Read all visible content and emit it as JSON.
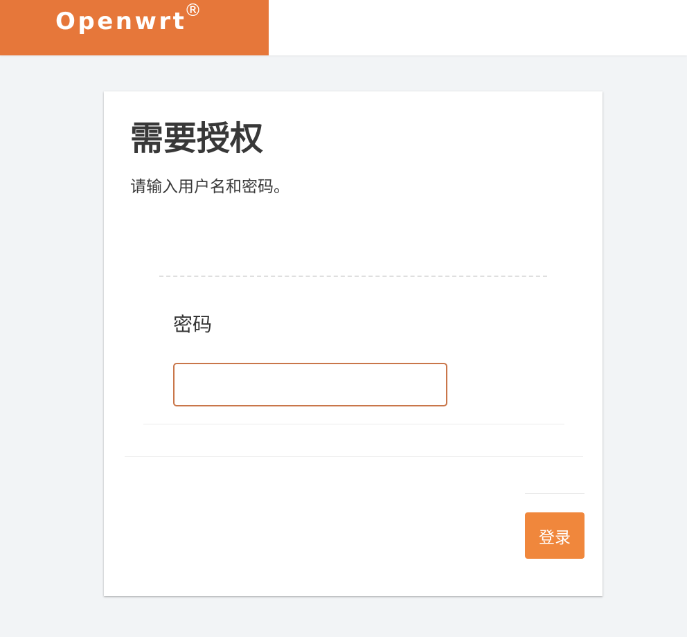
{
  "header": {
    "brand_name": "Openwrt",
    "brand_mark": "®"
  },
  "login": {
    "title": "需要授权",
    "description": "请输入用户名和密码。",
    "password_label": "密码",
    "password_value": "",
    "submit_label": "登录"
  },
  "colors": {
    "brand": "#e6773a",
    "button": "#f0873c",
    "input_border": "#c9764a",
    "page_background": "#f2f4f6"
  }
}
